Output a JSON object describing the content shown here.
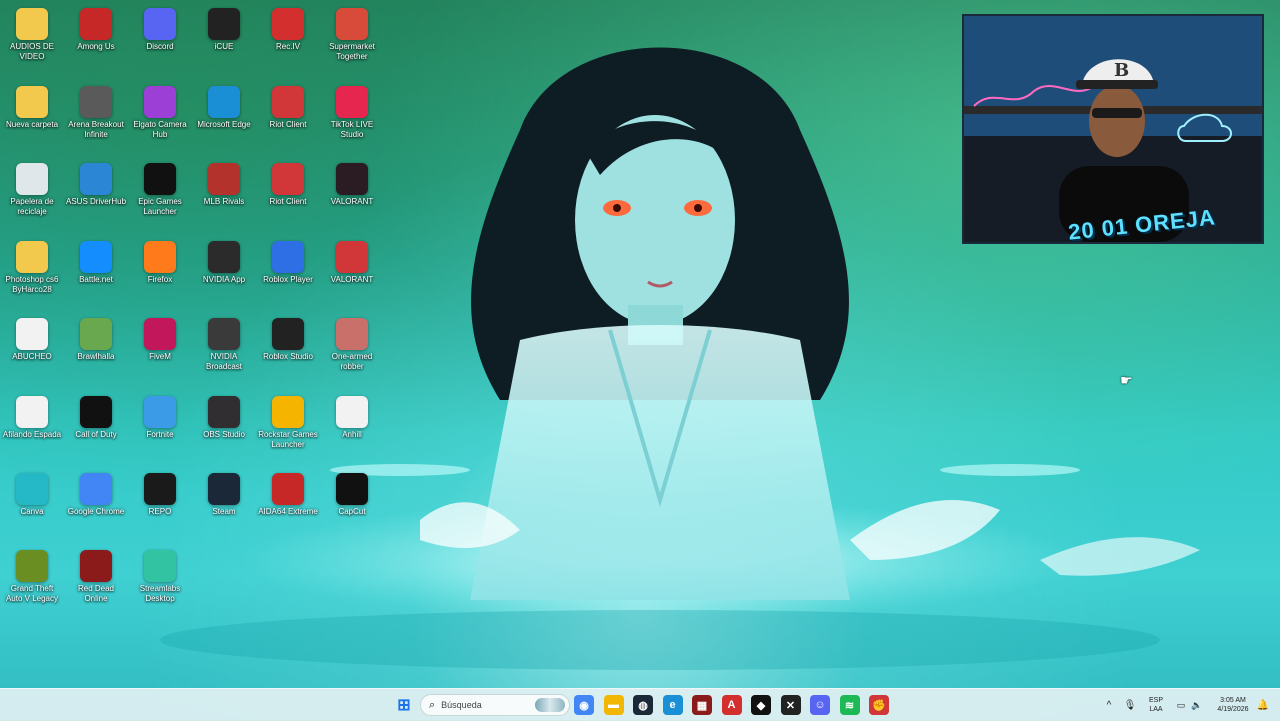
{
  "desktop": {
    "icons": [
      {
        "label": "AUDIOS DE VIDEO",
        "icon": "folder-icon",
        "color": "#f2c94c"
      },
      {
        "label": "Among Us",
        "icon": "among-us-icon",
        "color": "#c62828"
      },
      {
        "label": "Discord",
        "icon": "discord-icon",
        "color": "#5865f2"
      },
      {
        "label": "iCUE",
        "icon": "icue-icon",
        "color": "#222222"
      },
      {
        "label": "Rec.IV",
        "icon": "record-icon",
        "color": "#d32f2f"
      },
      {
        "label": "Supermarket Together",
        "icon": "supermarket-icon",
        "color": "#d84a3a"
      },
      {
        "label": "Nueva carpeta",
        "icon": "folder-icon",
        "color": "#f2c94c"
      },
      {
        "label": "Arena Breakout Infinite",
        "icon": "arena-breakout-icon",
        "color": "#5a5a5a"
      },
      {
        "label": "Elgato Camera Hub",
        "icon": "elgato-icon",
        "color": "#9b3fd6"
      },
      {
        "label": "Microsoft Edge",
        "icon": "edge-icon",
        "color": "#1a8fd6"
      },
      {
        "label": "Riot Client",
        "icon": "riot-client-icon",
        "color": "#d13639"
      },
      {
        "label": "TikTok LIVE Studio",
        "icon": "tiktok-live-icon",
        "color": "#e6264f"
      },
      {
        "label": "Papelera de reciclaje",
        "icon": "recycle-bin-icon",
        "color": "#dfe7ea"
      },
      {
        "label": "ASUS DriverHub",
        "icon": "asus-driverhub-icon",
        "color": "#2b86d6"
      },
      {
        "label": "Epic Games Launcher",
        "icon": "epic-games-icon",
        "color": "#111111"
      },
      {
        "label": "MLB Rivals",
        "icon": "mlb-rivals-icon",
        "color": "#b3332c"
      },
      {
        "label": "Riot Client",
        "icon": "riot-client-icon",
        "color": "#d13639"
      },
      {
        "label": "VALORANT",
        "icon": "valorant-icon",
        "color": "#2b1b22"
      },
      {
        "label": "Photoshop cs6 ByHarco28",
        "icon": "folder-icon",
        "color": "#f2c94c"
      },
      {
        "label": "Battle.net",
        "icon": "battlenet-icon",
        "color": "#148eff"
      },
      {
        "label": "Firefox",
        "icon": "firefox-icon",
        "color": "#ff7a1a"
      },
      {
        "label": "NVIDIA App",
        "icon": "nvidia-icon",
        "color": "#2b2b2b"
      },
      {
        "label": "Roblox Player",
        "icon": "roblox-icon",
        "color": "#2f6fe6"
      },
      {
        "label": "VALORANT",
        "icon": "valorant-icon",
        "color": "#d13639"
      },
      {
        "label": "ABUCHEO",
        "icon": "media-file-icon",
        "color": "#f2f2f2"
      },
      {
        "label": "Brawlhalla",
        "icon": "brawlhalla-icon",
        "color": "#6aa84f"
      },
      {
        "label": "FiveM",
        "icon": "fivem-icon",
        "color": "#c2185b"
      },
      {
        "label": "NVIDIA Broadcast",
        "icon": "nvidia-broadcast-icon",
        "color": "#3a3a3a"
      },
      {
        "label": "Roblox Studio",
        "icon": "roblox-studio-icon",
        "color": "#222222"
      },
      {
        "label": "One-armed robber",
        "icon": "one-armed-robber-icon",
        "color": "#c9706a"
      },
      {
        "label": "Afilando Espada",
        "icon": "media-file-icon",
        "color": "#f2f2f2"
      },
      {
        "label": "Call of Duty",
        "icon": "call-of-duty-icon",
        "color": "#111111"
      },
      {
        "label": "Fortnite",
        "icon": "fortnite-icon",
        "color": "#3b9be6"
      },
      {
        "label": "OBS Studio",
        "icon": "obs-icon",
        "color": "#302e31"
      },
      {
        "label": "Rockstar Games Launcher",
        "icon": "rockstar-icon",
        "color": "#f4b400"
      },
      {
        "label": "Anhill",
        "icon": "media-file-icon",
        "color": "#f2f2f2"
      },
      {
        "label": "Canva",
        "icon": "canva-icon",
        "color": "#25b8c6"
      },
      {
        "label": "Google Chrome",
        "icon": "chrome-icon",
        "color": "#4285f4"
      },
      {
        "label": "REPO",
        "icon": "repo-icon",
        "color": "#1a1a1a"
      },
      {
        "label": "Steam",
        "icon": "steam-icon",
        "color": "#1b2838"
      },
      {
        "label": "AIDA64 Extreme",
        "icon": "aida64-icon",
        "color": "#c62828"
      },
      {
        "label": "CapCut",
        "icon": "capcut-icon",
        "color": "#111111"
      },
      {
        "label": "Grand Theft Auto V Legacy",
        "icon": "gta-icon",
        "color": "#6b8e23"
      },
      {
        "label": "Red Dead Online",
        "icon": "red-dead-icon",
        "color": "#8b1a1a"
      },
      {
        "label": "Streamlabs Desktop",
        "icon": "streamlabs-icon",
        "color": "#31c3a2"
      }
    ]
  },
  "overlay": {
    "webcam_tag": "20 01 OREJA"
  },
  "taskbar": {
    "search_placeholder": "Búsqueda",
    "apps": [
      {
        "name": "chrome-icon",
        "color": "#4285f4",
        "glyph": "◉"
      },
      {
        "name": "file-explorer-icon",
        "color": "#f2b705",
        "glyph": "▬"
      },
      {
        "name": "steam-icon",
        "color": "#1b2838",
        "glyph": "◍"
      },
      {
        "name": "edge-icon",
        "color": "#1a8fd6",
        "glyph": "e"
      },
      {
        "name": "media-app-icon",
        "color": "#8b1a1a",
        "glyph": "▦"
      },
      {
        "name": "adobe-icon",
        "color": "#d32f2f",
        "glyph": "A"
      },
      {
        "name": "epic-icon",
        "color": "#111111",
        "glyph": "◆"
      },
      {
        "name": "capcut-icon",
        "color": "#222222",
        "glyph": "✕"
      },
      {
        "name": "discord-icon",
        "color": "#5865f2",
        "glyph": "☺"
      },
      {
        "name": "spotify-icon",
        "color": "#1db954",
        "glyph": "≋"
      },
      {
        "name": "riot-icon",
        "color": "#d13639",
        "glyph": "✊"
      }
    ],
    "lang_top": "ESP",
    "lang_bottom": "LAA",
    "time": "3:05 AM",
    "date": "4/19/2026"
  }
}
